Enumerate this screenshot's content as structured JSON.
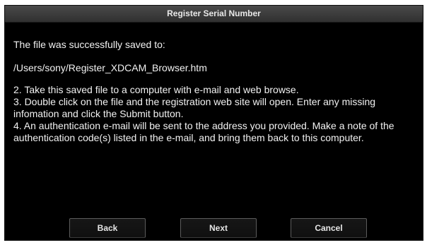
{
  "window": {
    "title": "Register Serial Number"
  },
  "message": {
    "saved_to": "The file was successfully saved to:",
    "path": "/Users/sony/Register_XDCAM_Browser.htm",
    "steps": [
      "2.  Take this saved file to a computer with e-mail and web browse.",
      "3.  Double click on the file and the registration web site will open. Enter any missing infomation and click the Submit button.",
      "4.  An authentication e-mail will be sent to the address you provided. Make a note of the authentication code(s) listed in the e-mail, and bring them back to this computer."
    ]
  },
  "buttons": {
    "back_label": "Back",
    "next_label": "Next",
    "cancel_label": "Cancel"
  },
  "colors": {
    "background": "#000000",
    "titlebar": "#3c3c3c",
    "text": "#f2f2f2"
  }
}
